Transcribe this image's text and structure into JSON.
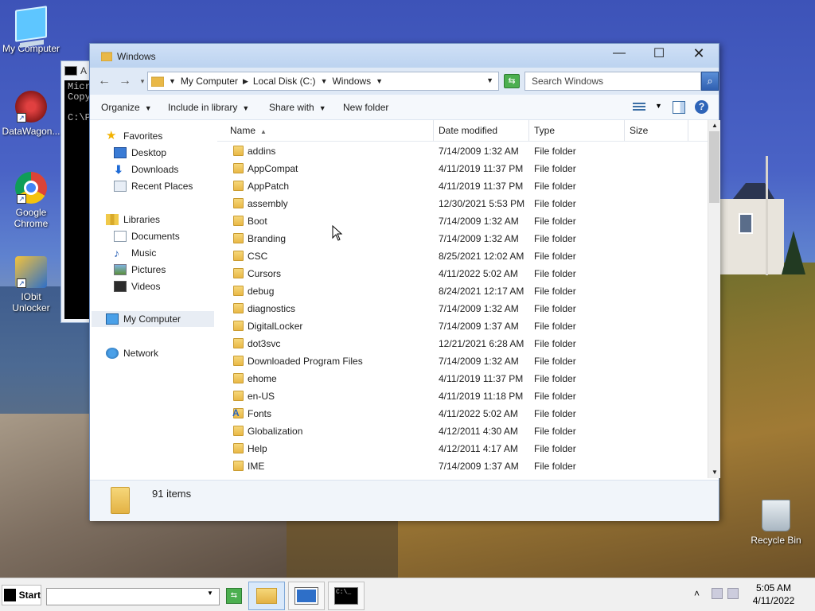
{
  "desktop": {
    "icons": [
      {
        "label": "My Computer"
      },
      {
        "label": "DataWagon..."
      },
      {
        "label": "Google Chrome"
      },
      {
        "label": "IObit Unlocker"
      },
      {
        "label": "Recycle Bin"
      }
    ],
    "cmd_window": {
      "title": "A",
      "lines": "Micr\nCopy\n\nC:\\P"
    }
  },
  "explorer": {
    "title": "Windows",
    "breadcrumb": [
      "My Computer",
      "Local Disk (C:)",
      "Windows"
    ],
    "search_placeholder": "Search Windows",
    "toolbar": {
      "organize": "Organize",
      "include_in_library": "Include in library",
      "share_with": "Share with",
      "new_folder": "New folder"
    },
    "nav": {
      "favorites": "Favorites",
      "desktop": "Desktop",
      "downloads": "Downloads",
      "recent_places": "Recent Places",
      "libraries": "Libraries",
      "documents": "Documents",
      "music": "Music",
      "pictures": "Pictures",
      "videos": "Videos",
      "my_computer": "My Computer",
      "network": "Network"
    },
    "columns": {
      "name": "Name",
      "date_modified": "Date modified",
      "type": "Type",
      "size": "Size"
    },
    "files": [
      {
        "name": "addins",
        "date": "7/14/2009 1:32 AM",
        "type": "File folder",
        "icon": "folder-icon"
      },
      {
        "name": "AppCompat",
        "date": "4/11/2019 11:37 PM",
        "type": "File folder",
        "icon": "folder-icon"
      },
      {
        "name": "AppPatch",
        "date": "4/11/2019 11:37 PM",
        "type": "File folder",
        "icon": "folder-icon"
      },
      {
        "name": "assembly",
        "date": "12/30/2021 5:53 PM",
        "type": "File folder",
        "icon": "folder-icon"
      },
      {
        "name": "Boot",
        "date": "7/14/2009 1:32 AM",
        "type": "File folder",
        "icon": "folder-icon"
      },
      {
        "name": "Branding",
        "date": "7/14/2009 1:32 AM",
        "type": "File folder",
        "icon": "folder-icon"
      },
      {
        "name": "CSC",
        "date": "8/25/2021 12:02 AM",
        "type": "File folder",
        "icon": "folder-icon"
      },
      {
        "name": "Cursors",
        "date": "4/11/2022 5:02 AM",
        "type": "File folder",
        "icon": "folder-icon"
      },
      {
        "name": "debug",
        "date": "8/24/2021 12:17 AM",
        "type": "File folder",
        "icon": "folder-icon"
      },
      {
        "name": "diagnostics",
        "date": "7/14/2009 1:32 AM",
        "type": "File folder",
        "icon": "folder-icon"
      },
      {
        "name": "DigitalLocker",
        "date": "7/14/2009 1:37 AM",
        "type": "File folder",
        "icon": "folder-icon"
      },
      {
        "name": "dot3svc",
        "date": "12/21/2021 6:28 AM",
        "type": "File folder",
        "icon": "folder-icon"
      },
      {
        "name": "Downloaded Program Files",
        "date": "7/14/2009 1:32 AM",
        "type": "File folder",
        "icon": "folder-icon"
      },
      {
        "name": "ehome",
        "date": "4/11/2019 11:37 PM",
        "type": "File folder",
        "icon": "folder-icon"
      },
      {
        "name": "en-US",
        "date": "4/11/2019 11:18 PM",
        "type": "File folder",
        "icon": "folder-icon"
      },
      {
        "name": "Fonts",
        "date": "4/11/2022 5:02 AM",
        "type": "File folder",
        "icon": "fonts-folder-icon"
      },
      {
        "name": "Globalization",
        "date": "4/12/2011 4:30 AM",
        "type": "File folder",
        "icon": "folder-icon"
      },
      {
        "name": "Help",
        "date": "4/12/2011 4:17 AM",
        "type": "File folder",
        "icon": "folder-icon"
      },
      {
        "name": "IME",
        "date": "7/14/2009 1:37 AM",
        "type": "File folder",
        "icon": "folder-icon"
      }
    ],
    "status": "91 items"
  },
  "taskbar": {
    "start": "Start",
    "time": "5:05 AM",
    "date": "4/11/2022"
  }
}
